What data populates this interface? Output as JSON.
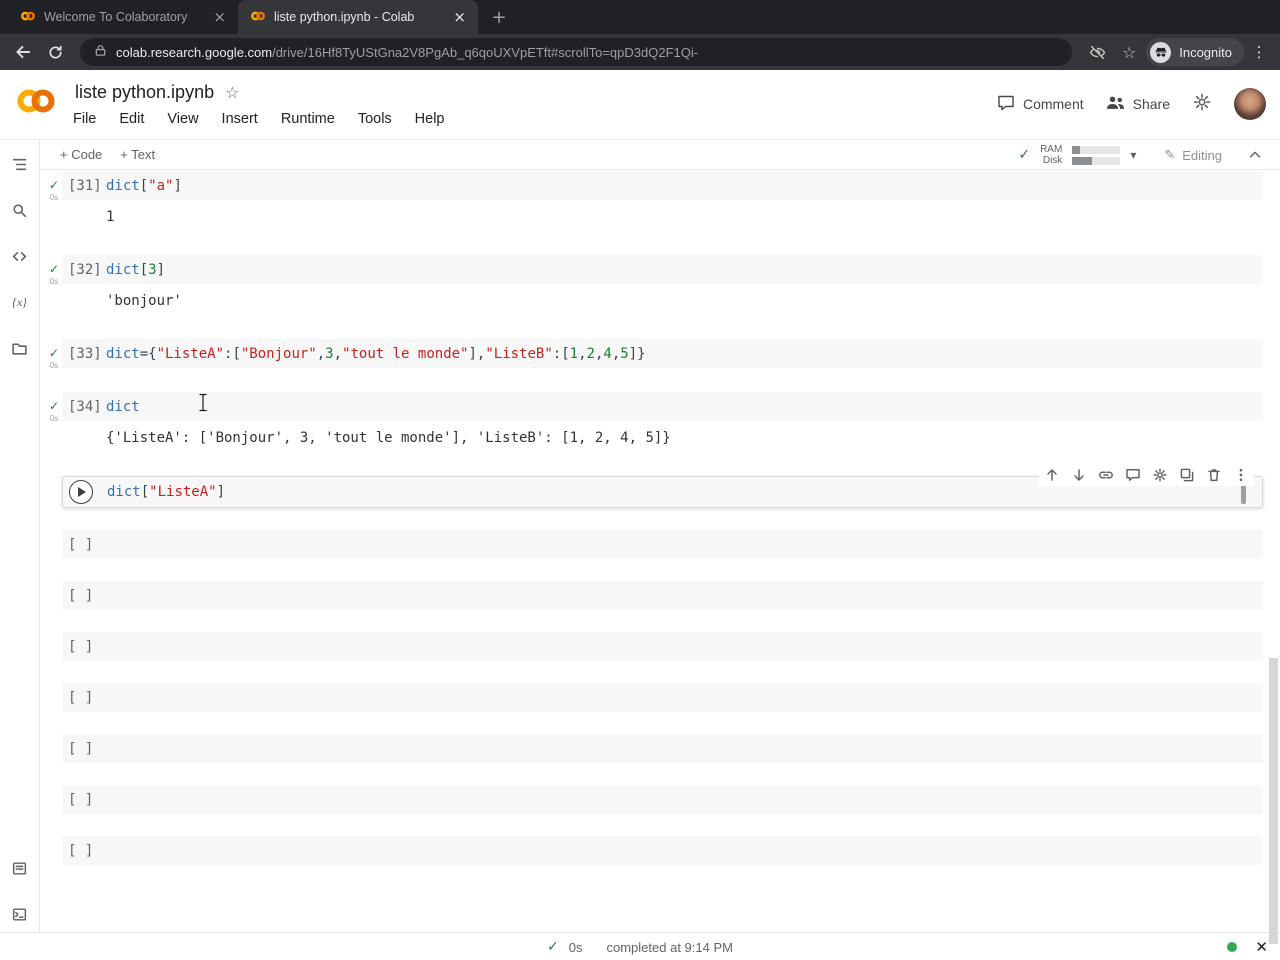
{
  "browser": {
    "tabs": [
      {
        "title": "Welcome To Colaboratory"
      },
      {
        "title": "liste python.ipynb - Colab"
      }
    ],
    "url_domain": "colab.research.google.com",
    "url_path": "/drive/16Hf8TyUStGna2V8PgAb_q6qoUXVpETft#scrollTo=qpD3dQ2F1Qi-",
    "incognito_label": "Incognito"
  },
  "header": {
    "title": "liste python.ipynb",
    "menus": [
      "File",
      "Edit",
      "View",
      "Insert",
      "Runtime",
      "Tools",
      "Help"
    ],
    "comment_label": "Comment",
    "share_label": "Share"
  },
  "toolbar": {
    "add_code_label": "+ Code",
    "add_text_label": "+ Text",
    "ram_label": "RAM",
    "disk_label": "Disk",
    "ram_fill": 0.16,
    "disk_fill": 0.42,
    "editing_label": "Editing"
  },
  "sidebar": {
    "items": [
      "table-of-contents",
      "find-and-replace",
      "code-snippets",
      "variables",
      "files"
    ],
    "bottom_items": [
      "console",
      "terminal"
    ]
  },
  "notebook": {
    "cell_toolbar_icons": [
      "move-cell-up",
      "move-cell-down",
      "copy-link-to-cell",
      "add-comment",
      "open-editor-settings",
      "mirror-cell-in-tab",
      "delete-cell",
      "more-cell-actions"
    ],
    "cells": [
      {
        "kind": "code",
        "status": "ok",
        "time": "0s",
        "count": "[31]",
        "tokens": [
          [
            "id",
            "dict"
          ],
          [
            "p",
            "["
          ],
          [
            "str",
            "\"a\""
          ],
          [
            "p",
            "]"
          ]
        ],
        "output": "1"
      },
      {
        "kind": "code",
        "status": "ok",
        "time": "0s",
        "count": "[32]",
        "tokens": [
          [
            "id",
            "dict"
          ],
          [
            "p",
            "["
          ],
          [
            "num",
            "3"
          ],
          [
            "p",
            "]"
          ]
        ],
        "output": "'bonjour'"
      },
      {
        "kind": "code",
        "status": "ok",
        "time": "0s",
        "count": "[33]",
        "tokens": [
          [
            "id",
            "dict"
          ],
          [
            "p",
            "={"
          ],
          [
            "str",
            "\"ListeA\""
          ],
          [
            "p",
            ":["
          ],
          [
            "str",
            "\"Bonjour\""
          ],
          [
            "p",
            ","
          ],
          [
            "num",
            "3"
          ],
          [
            "p",
            ","
          ],
          [
            "str",
            "\"tout le monde\""
          ],
          [
            "p",
            "],"
          ],
          [
            "str",
            "\"ListeB\""
          ],
          [
            "p",
            ":["
          ],
          [
            "num",
            "1"
          ],
          [
            "p",
            ","
          ],
          [
            "num",
            "2"
          ],
          [
            "p",
            ","
          ],
          [
            "num",
            "4"
          ],
          [
            "p",
            ","
          ],
          [
            "num",
            "5"
          ],
          [
            "p",
            "]}"
          ]
        ]
      },
      {
        "kind": "code",
        "status": "ok",
        "time": "0s",
        "count": "[34]",
        "tokens": [
          [
            "id",
            "dict"
          ]
        ],
        "output": "{'ListeA': ['Bonjour', 3, 'tout le monde'], 'ListeB': [1, 2, 4, 5]}"
      },
      {
        "kind": "focused",
        "tokens": [
          [
            "id",
            "dict"
          ],
          [
            "p",
            "["
          ],
          [
            "str",
            "\"ListeA\""
          ],
          [
            "p",
            "]"
          ]
        ]
      },
      {
        "kind": "empty",
        "count": "[ ]"
      },
      {
        "kind": "empty",
        "count": "[ ]"
      },
      {
        "kind": "empty",
        "count": "[ ]"
      },
      {
        "kind": "empty",
        "count": "[ ]"
      },
      {
        "kind": "empty",
        "count": "[ ]"
      },
      {
        "kind": "empty",
        "count": "[ ]"
      },
      {
        "kind": "empty",
        "count": "[ ]"
      }
    ]
  },
  "statusbar": {
    "time": "0s",
    "message": "completed at 9:14 PM"
  },
  "colors": {
    "brand_yellow": "#F9AB00",
    "brand_orange": "#E8710A",
    "check_green": "#188038",
    "status_green": "#34A853",
    "tok_id": "#3572B0",
    "tok_str": "#C5221F",
    "tok_num": "#188038",
    "tok_p": "#37474F"
  }
}
